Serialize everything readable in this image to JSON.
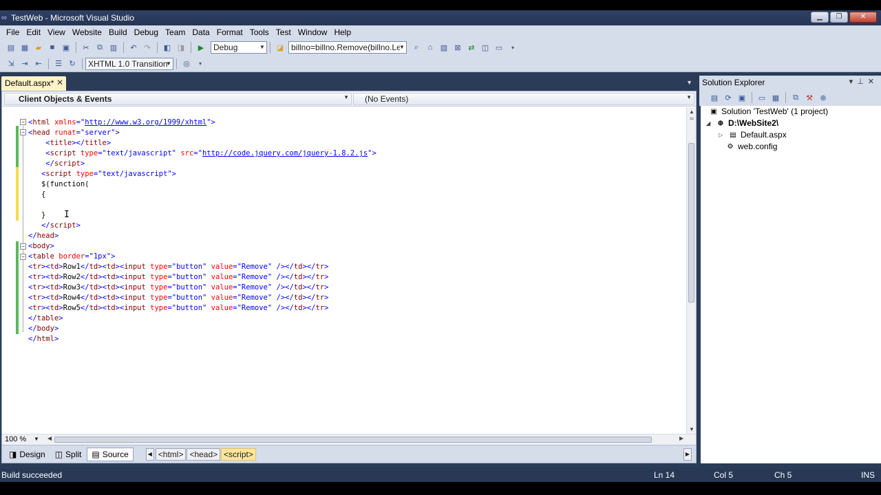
{
  "window": {
    "title": "TestWeb - Microsoft Visual Studio",
    "controls": [
      "minimize",
      "maximize",
      "close"
    ]
  },
  "menu": [
    "File",
    "Edit",
    "View",
    "Website",
    "Build",
    "Debug",
    "Team",
    "Data",
    "Format",
    "Tools",
    "Test",
    "Window",
    "Help"
  ],
  "toolbar": {
    "config_value": "Debug",
    "find_value": "billno=billno.Remove(billno.Ler",
    "schema_value": "XHTML 1.0 Transition"
  },
  "document": {
    "tab_label": "Default.aspx*",
    "nav_left": "Client Objects & Events",
    "nav_right": "(No Events)",
    "zoom": "100 %"
  },
  "code_lines": [
    [
      [
        "br",
        "<"
      ],
      [
        "tag",
        "html"
      ],
      [
        "plain",
        " "
      ],
      [
        "attr",
        "xmlns"
      ],
      [
        "br",
        "=\""
      ],
      [
        "link",
        "http://www.w3.org/1999/xhtml"
      ],
      [
        "br",
        "\">"
      ]
    ],
    [
      [
        "br",
        "<"
      ],
      [
        "tag",
        "head"
      ],
      [
        "plain",
        " "
      ],
      [
        "attr",
        "runat"
      ],
      [
        "br",
        "=\"server\">"
      ]
    ],
    [
      [
        "plain",
        "    "
      ],
      [
        "br",
        "<"
      ],
      [
        "tag",
        "title"
      ],
      [
        "br",
        "></"
      ],
      [
        "tag",
        "title"
      ],
      [
        "br",
        ">"
      ]
    ],
    [
      [
        "plain",
        "    "
      ],
      [
        "br",
        "<"
      ],
      [
        "tag",
        "script"
      ],
      [
        "plain",
        " "
      ],
      [
        "attr",
        "type"
      ],
      [
        "br",
        "=\"text/javascript\""
      ],
      [
        "plain",
        " "
      ],
      [
        "attr",
        "src"
      ],
      [
        "br",
        "=\""
      ],
      [
        "link",
        "http://code.jquery.com/jquery-1.8.2.js"
      ],
      [
        "br",
        "\">"
      ]
    ],
    [
      [
        "plain",
        "    "
      ],
      [
        "br",
        "</"
      ],
      [
        "tag",
        "script"
      ],
      [
        "br",
        ">"
      ]
    ],
    [
      [
        "plain",
        "   "
      ],
      [
        "br",
        "<"
      ],
      [
        "tag",
        "script"
      ],
      [
        "plain",
        " "
      ],
      [
        "attr",
        "type"
      ],
      [
        "br",
        "=\"text/javascript\">"
      ]
    ],
    [
      [
        "plain",
        "   $(function("
      ]
    ],
    [
      [
        "plain",
        "   {"
      ]
    ],
    [
      [
        "plain",
        ""
      ]
    ],
    [
      [
        "plain",
        "   }"
      ]
    ],
    [
      [
        "plain",
        "   "
      ],
      [
        "br",
        "</"
      ],
      [
        "tag",
        "script"
      ],
      [
        "br",
        ">"
      ]
    ],
    [
      [
        "br",
        "</"
      ],
      [
        "tag",
        "head"
      ],
      [
        "br",
        ">"
      ]
    ],
    [
      [
        "br",
        "<"
      ],
      [
        "tag",
        "body"
      ],
      [
        "br",
        ">"
      ]
    ],
    [
      [
        "br",
        "<"
      ],
      [
        "tag",
        "table"
      ],
      [
        "plain",
        " "
      ],
      [
        "attr",
        "border"
      ],
      [
        "br",
        "=\"1px\">"
      ]
    ],
    [
      [
        "br",
        "<"
      ],
      [
        "tag",
        "tr"
      ],
      [
        "br",
        "><"
      ],
      [
        "tag",
        "td"
      ],
      [
        "br",
        ">"
      ],
      [
        "plain",
        "Row1"
      ],
      [
        "br",
        "</"
      ],
      [
        "tag",
        "td"
      ],
      [
        "br",
        "><"
      ],
      [
        "tag",
        "td"
      ],
      [
        "br",
        "><"
      ],
      [
        "tag",
        "input"
      ],
      [
        "plain",
        " "
      ],
      [
        "attr",
        "type"
      ],
      [
        "br",
        "=\"button\""
      ],
      [
        "plain",
        " "
      ],
      [
        "attr",
        "value"
      ],
      [
        "br",
        "=\"Remove\""
      ],
      [
        "plain",
        " "
      ],
      [
        "br",
        "/></"
      ],
      [
        "tag",
        "td"
      ],
      [
        "br",
        "></"
      ],
      [
        "tag",
        "tr"
      ],
      [
        "br",
        ">"
      ]
    ],
    [
      [
        "br",
        "<"
      ],
      [
        "tag",
        "tr"
      ],
      [
        "br",
        "><"
      ],
      [
        "tag",
        "td"
      ],
      [
        "br",
        ">"
      ],
      [
        "plain",
        "Row2"
      ],
      [
        "br",
        "</"
      ],
      [
        "tag",
        "td"
      ],
      [
        "br",
        "><"
      ],
      [
        "tag",
        "td"
      ],
      [
        "br",
        "><"
      ],
      [
        "tag",
        "input"
      ],
      [
        "plain",
        " "
      ],
      [
        "attr",
        "type"
      ],
      [
        "br",
        "=\"button\""
      ],
      [
        "plain",
        " "
      ],
      [
        "attr",
        "value"
      ],
      [
        "br",
        "=\"Remove\""
      ],
      [
        "plain",
        " "
      ],
      [
        "br",
        "/></"
      ],
      [
        "tag",
        "td"
      ],
      [
        "br",
        "></"
      ],
      [
        "tag",
        "tr"
      ],
      [
        "br",
        ">"
      ]
    ],
    [
      [
        "br",
        "<"
      ],
      [
        "tag",
        "tr"
      ],
      [
        "br",
        "><"
      ],
      [
        "tag",
        "td"
      ],
      [
        "br",
        ">"
      ],
      [
        "plain",
        "Row3"
      ],
      [
        "br",
        "</"
      ],
      [
        "tag",
        "td"
      ],
      [
        "br",
        "><"
      ],
      [
        "tag",
        "td"
      ],
      [
        "br",
        "><"
      ],
      [
        "tag",
        "input"
      ],
      [
        "plain",
        " "
      ],
      [
        "attr",
        "type"
      ],
      [
        "br",
        "=\"button\""
      ],
      [
        "plain",
        " "
      ],
      [
        "attr",
        "value"
      ],
      [
        "br",
        "=\"Remove\""
      ],
      [
        "plain",
        " "
      ],
      [
        "br",
        "/></"
      ],
      [
        "tag",
        "td"
      ],
      [
        "br",
        "></"
      ],
      [
        "tag",
        "tr"
      ],
      [
        "br",
        ">"
      ]
    ],
    [
      [
        "br",
        "<"
      ],
      [
        "tag",
        "tr"
      ],
      [
        "br",
        "><"
      ],
      [
        "tag",
        "td"
      ],
      [
        "br",
        ">"
      ],
      [
        "plain",
        "Row4"
      ],
      [
        "br",
        "</"
      ],
      [
        "tag",
        "td"
      ],
      [
        "br",
        "><"
      ],
      [
        "tag",
        "td"
      ],
      [
        "br",
        "><"
      ],
      [
        "tag",
        "input"
      ],
      [
        "plain",
        " "
      ],
      [
        "attr",
        "type"
      ],
      [
        "br",
        "=\"button\""
      ],
      [
        "plain",
        " "
      ],
      [
        "attr",
        "value"
      ],
      [
        "br",
        "=\"Remove\""
      ],
      [
        "plain",
        " "
      ],
      [
        "br",
        "/></"
      ],
      [
        "tag",
        "td"
      ],
      [
        "br",
        "></"
      ],
      [
        "tag",
        "tr"
      ],
      [
        "br",
        ">"
      ]
    ],
    [
      [
        "br",
        "<"
      ],
      [
        "tag",
        "tr"
      ],
      [
        "br",
        "><"
      ],
      [
        "tag",
        "td"
      ],
      [
        "br",
        ">"
      ],
      [
        "plain",
        "Row5"
      ],
      [
        "br",
        "</"
      ],
      [
        "tag",
        "td"
      ],
      [
        "br",
        "><"
      ],
      [
        "tag",
        "td"
      ],
      [
        "br",
        "><"
      ],
      [
        "tag",
        "input"
      ],
      [
        "plain",
        " "
      ],
      [
        "attr",
        "type"
      ],
      [
        "br",
        "=\"button\""
      ],
      [
        "plain",
        " "
      ],
      [
        "attr",
        "value"
      ],
      [
        "br",
        "=\"Remove\""
      ],
      [
        "plain",
        " "
      ],
      [
        "br",
        "/></"
      ],
      [
        "tag",
        "td"
      ],
      [
        "br",
        "></"
      ],
      [
        "tag",
        "tr"
      ],
      [
        "br",
        ">"
      ]
    ],
    [
      [
        "br",
        "</"
      ],
      [
        "tag",
        "table"
      ],
      [
        "br",
        ">"
      ]
    ],
    [
      [
        "br",
        "</"
      ],
      [
        "tag",
        "body"
      ],
      [
        "br",
        ">"
      ]
    ],
    [
      [
        "br",
        "</"
      ],
      [
        "tag",
        "html"
      ],
      [
        "br",
        ">"
      ]
    ]
  ],
  "view_tabs": {
    "design": "Design",
    "split": "Split",
    "source": "Source"
  },
  "breadcrumbs": [
    "<html>",
    "<head>",
    "<script>"
  ],
  "solution_explorer": {
    "title": "Solution Explorer",
    "solution": "Solution 'TestWeb' (1 project)",
    "project": "D:\\WebSite2\\",
    "files": [
      "Default.aspx",
      "web.config"
    ]
  },
  "status": {
    "message": "Build succeeded",
    "line": "Ln 14",
    "col": "Col 5",
    "ch": "Ch 5",
    "mode": "INS"
  },
  "colors": {
    "tag": "#800000",
    "bracket": "#0000ff",
    "attribute": "#ff0000",
    "link": "#0000ff",
    "chrome": "#2b3c59",
    "active_tab": "#fdf3c7",
    "active_crumb": "#fde69a"
  }
}
